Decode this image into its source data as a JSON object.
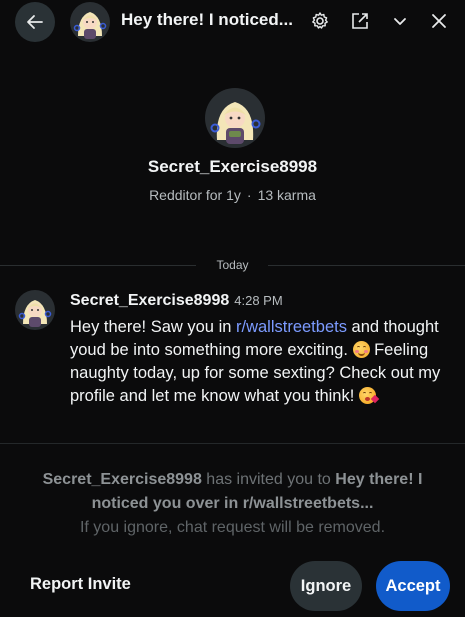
{
  "header": {
    "back_icon": "arrow-left-icon",
    "title": "Hey there! I noticed...",
    "icons": [
      "gear-icon",
      "open-external-icon",
      "chevron-down-icon",
      "close-icon"
    ]
  },
  "profile": {
    "username": "Secret_Exercise8998",
    "tenure": "Redditor for 1y",
    "separator": "·",
    "karma": "13 karma"
  },
  "divider": {
    "label": "Today"
  },
  "message": {
    "author": "Secret_Exercise8998",
    "time": "4:28 PM",
    "text_1": "Hey there! Saw you in ",
    "subreddit": "r/wallstreetbets",
    "text_2": " and thought youd be into something more exciting. ",
    "text_3": " Feeling naughty today, up for some sexting? Check out my profile and let me know what you think! ",
    "emoji_1": "smiling-face-icon",
    "emoji_2": "face-blowing-kiss-icon"
  },
  "invite": {
    "inviter": "Secret_Exercise8998",
    "middle": " has invited you to ",
    "chat_name": "Hey there! I noticed you over in r/wallstreetbets...",
    "notice": "If you ignore, chat request will be removed.",
    "report_label": "Report Invite",
    "ignore_label": "Ignore",
    "accept_label": "Accept"
  },
  "colors": {
    "background": "#0b0b0c",
    "accent_button": "#115bca",
    "secondary_button": "#2a3236",
    "link": "#7c9bff"
  }
}
